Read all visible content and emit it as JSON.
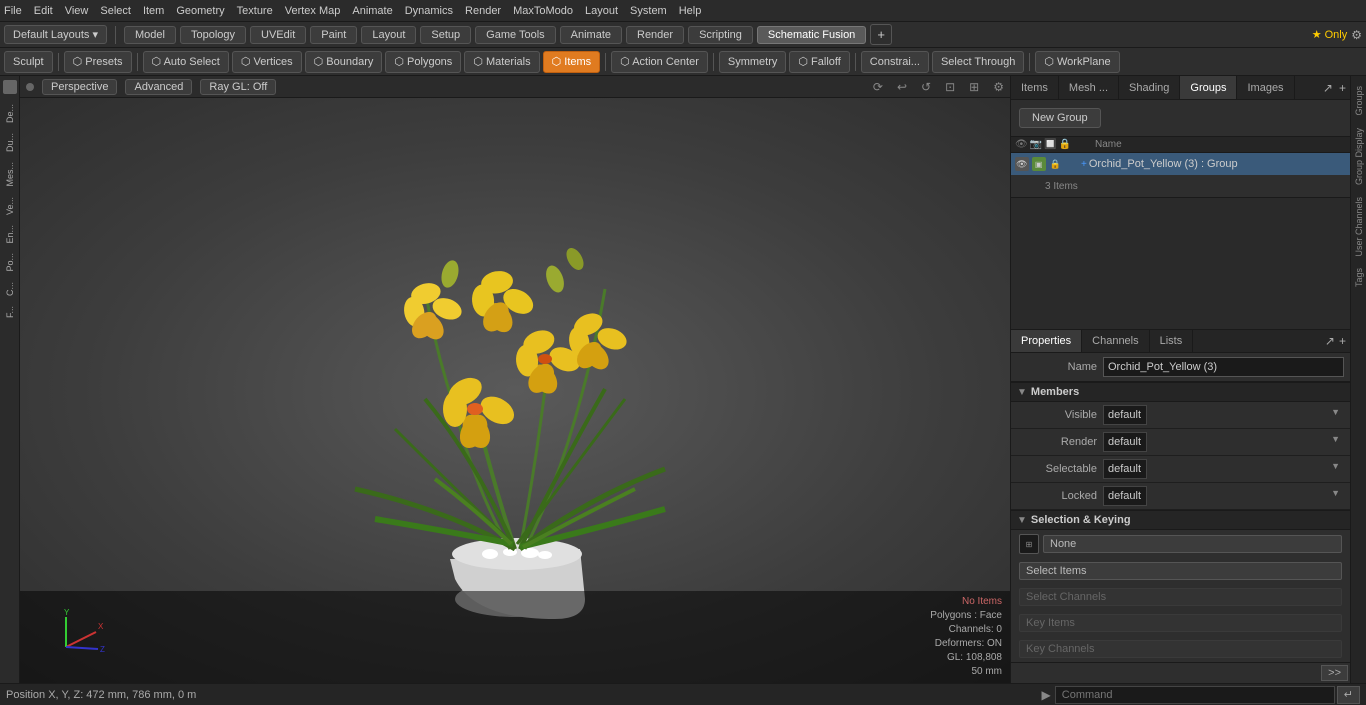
{
  "menubar": {
    "items": [
      "File",
      "Edit",
      "View",
      "Select",
      "Item",
      "Geometry",
      "Texture",
      "Vertex Map",
      "Animate",
      "Dynamics",
      "Render",
      "MaxToModo",
      "Layout",
      "System",
      "Help"
    ]
  },
  "toolbar1": {
    "layouts_label": "Default Layouts ▾",
    "tabs": [
      "Model",
      "Topology",
      "UVEdit",
      "Paint",
      "Layout",
      "Setup",
      "Game Tools",
      "Animate",
      "Render",
      "Scripting",
      "Schematic Fusion"
    ],
    "active_tab": "Schematic Fusion",
    "special_tab": "★ Only",
    "plus_label": "+",
    "gear_label": "⚙"
  },
  "toolbar2": {
    "buttons": [
      {
        "label": "Sculpt",
        "active": false
      },
      {
        "label": "⬡ Presets",
        "active": false
      },
      {
        "label": "⬡ Auto Select",
        "active": false
      },
      {
        "label": "⬡ Vertices",
        "active": false
      },
      {
        "label": "⬡ Boundary",
        "active": false
      },
      {
        "label": "⬡ Polygons",
        "active": false
      },
      {
        "label": "⬡ Materials",
        "active": false
      },
      {
        "label": "⬡ Items",
        "active": true
      },
      {
        "label": "⬡ Action Center",
        "active": false
      },
      {
        "label": "Symmetry",
        "active": false
      },
      {
        "label": "⬡ Falloff",
        "active": false
      },
      {
        "label": "Constrai...",
        "active": false
      },
      {
        "label": "Select Through",
        "active": false
      },
      {
        "label": "⬡ WorkPlane",
        "active": false
      }
    ]
  },
  "left_sidebar": {
    "items": [
      "De...",
      "Du...",
      "Me...",
      "Ve...",
      "En...",
      "Po...",
      "C...",
      "F..."
    ]
  },
  "viewport": {
    "perspective": "Perspective",
    "mode": "Advanced",
    "ray_gl": "Ray GL: Off",
    "icons": [
      "⟳",
      "↩",
      "↺",
      "⊡",
      "⊞",
      "⚙"
    ]
  },
  "status": {
    "no_items": "No Items",
    "poly_face": "Polygons : Face",
    "channels": "Channels: 0",
    "deformers": "Deformers: ON",
    "gl": "GL: 108,808",
    "mm": "50 mm"
  },
  "position": {
    "text": "Position X, Y, Z:   472 mm, 786 mm, 0 m"
  },
  "right_panel": {
    "tabs": [
      "Items",
      "Mesh ...",
      "Shading",
      "Groups",
      "Images"
    ],
    "active_tab": "Groups",
    "expand_icon": "↗",
    "plus_icon": "+"
  },
  "groups": {
    "new_group_label": "New Group",
    "columns": [
      "Name"
    ],
    "items": [
      {
        "name": "Orchid_Pot_Yellow (3) : Group",
        "subtext": "3 Items"
      }
    ]
  },
  "properties": {
    "tabs": [
      "Properties",
      "Channels",
      "Lists"
    ],
    "active_tab": "Properties",
    "name_label": "Name",
    "name_value": "Orchid_Pot_Yellow (3)",
    "sections": {
      "members": {
        "title": "Members",
        "fields": [
          {
            "label": "Visible",
            "value": "default"
          },
          {
            "label": "Render",
            "value": "default"
          },
          {
            "label": "Selectable",
            "value": "default"
          },
          {
            "label": "Locked",
            "value": "default"
          }
        ]
      },
      "selection_keying": {
        "title": "Selection & Keying",
        "icon_label": "None",
        "buttons": [
          {
            "label": "Select Items",
            "disabled": false
          },
          {
            "label": "Select Channels",
            "disabled": true
          },
          {
            "label": "Key Items",
            "disabled": true
          },
          {
            "label": "Key Channels",
            "disabled": true
          }
        ]
      }
    }
  },
  "right_vtabs": {
    "items": [
      "Groups",
      "Group Display",
      "User Channels",
      "Tags"
    ]
  },
  "command": {
    "arrow": "▶",
    "placeholder": "Command",
    "submit_icon": "↵"
  }
}
